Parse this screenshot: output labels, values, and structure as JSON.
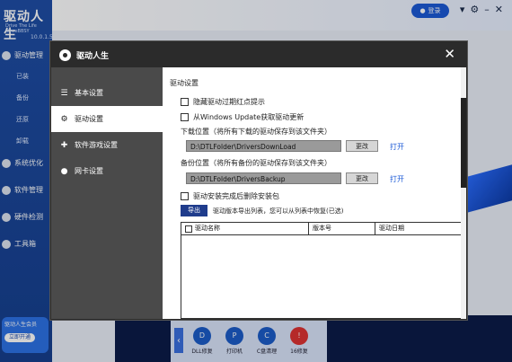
{
  "app": {
    "logo": "驱动人生",
    "logo_sub": "Drive The Life SinceBBSY",
    "version": "10.0.1.5",
    "nav": [
      "驱动管理",
      "系统优化",
      "软件管理",
      "硬件检测",
      "工具箱"
    ],
    "subnav": [
      "已装",
      "备份",
      "还原",
      "卸载"
    ],
    "user_label": "登录",
    "promo_text": "驱动人生会员",
    "promo_button": "立即开通",
    "tray_tools": [
      "DLL修复",
      "打印机",
      "C盘清理",
      "16修复"
    ]
  },
  "dialog": {
    "title": "驱动人生",
    "close_glyph": "✕",
    "sidebar": [
      {
        "label": "基本设置",
        "icon": "list-icon",
        "active": false
      },
      {
        "label": "驱动设置",
        "icon": "gear-icon",
        "active": true
      },
      {
        "label": "软件游戏设置",
        "icon": "gamepad-icon",
        "active": false
      },
      {
        "label": "网卡设置",
        "icon": "network-icon",
        "active": false
      }
    ],
    "content": {
      "section_title": "驱动设置",
      "options": [
        "隐藏驱动过期红点提示",
        "从Windows Update获取驱动更新"
      ],
      "download_label": "下载位置（将所有下载的驱动保存到该文件夹）",
      "download_path": "D:\\DTLFolder\\DriversDownLoad",
      "backup_label": "备份位置（将所有备份的驱动保存到该文件夹）",
      "backup_path": "D:\\DTLFolder\\DriversBackup",
      "change_label": "更改",
      "open_label": "打开",
      "extra_option": "驱动安装完成后删除安装包",
      "export_button": "导出",
      "export_hint": "驱动版本导出列表，您可以从列表中恢复(已选)",
      "table_columns": [
        "驱动名称",
        "版本号",
        "驱动日期"
      ]
    }
  }
}
